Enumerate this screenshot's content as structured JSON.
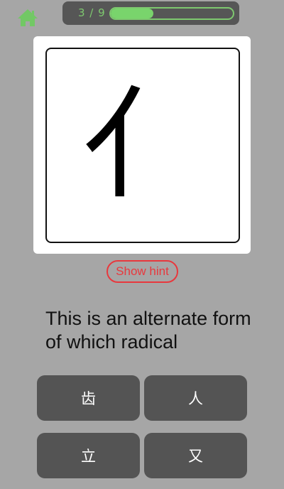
{
  "header": {
    "home_icon": "home-icon",
    "progress_text": "3 / 9",
    "progress_fraction": 0.35
  },
  "card": {
    "character": "亻"
  },
  "hint": {
    "label": "Show hint"
  },
  "question": {
    "text": "This is an alternate form of which radical"
  },
  "answers": [
    {
      "label": "齿"
    },
    {
      "label": "人"
    },
    {
      "label": "立"
    },
    {
      "label": "又"
    }
  ],
  "colors": {
    "background": "#a6a6a6",
    "accent_green": "#79d46c",
    "hint_red": "#e8383d",
    "button_gray": "#545454"
  }
}
